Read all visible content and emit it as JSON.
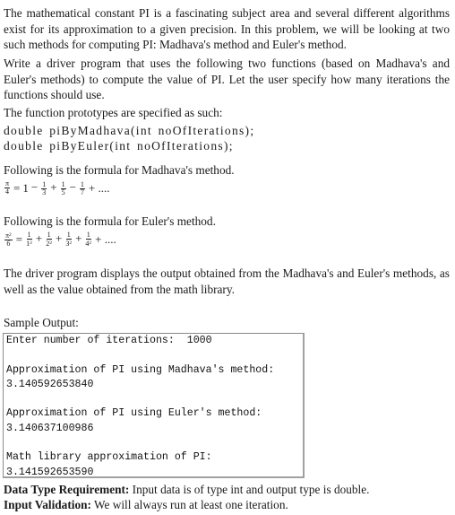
{
  "intro": {
    "paragraph1": "The mathematical constant PI is a fascinating subject area and several different algorithms exist for its approximation to a given precision. In this problem, we will be looking at two such methods for computing PI: Madhava's method and Euler's method.",
    "paragraph2": "Write a driver program that uses the following two functions (based on Madhava's and Euler's methods) to compute the value of PI. Let the user specify how many iterations the functions should use.",
    "prototypes_label": "The function prototypes are specified as such:"
  },
  "prototypes": [
    "double piByMadhava(int noOfIterations);",
    "double piByEuler(int noOfIterations);"
  ],
  "madhava": {
    "label": "Following is the formula for Madhava's method.",
    "lhs_num": "π",
    "lhs_den": "4",
    "first_term": "1",
    "terms": [
      {
        "op": "−",
        "num": "1",
        "den": "3"
      },
      {
        "op": "+",
        "num": "1",
        "den": "5"
      },
      {
        "op": "−",
        "num": "1",
        "den": "7"
      }
    ],
    "tail": "+ ...."
  },
  "euler": {
    "label": "Following is the formula for Euler's method.",
    "lhs_num": "π",
    "lhs_exp": "2",
    "lhs_den": "6",
    "terms": [
      {
        "op": "",
        "num": "1",
        "den": "1",
        "exp": "2"
      },
      {
        "op": "+",
        "num": "1",
        "den": "2",
        "exp": "2"
      },
      {
        "op": "+",
        "num": "1",
        "den": "3",
        "exp": "2"
      },
      {
        "op": "+",
        "num": "1",
        "den": "4",
        "exp": "2"
      }
    ],
    "tail": "+ ...."
  },
  "driver_text": "The driver program displays the output obtained from the Madhava's and Euler's methods, as well as the value obtained from the math library.",
  "sample_output": {
    "label": "Sample Output:",
    "lines": [
      "Enter number of iterations:  1000",
      "",
      "Approximation of PI using Madhava's method:",
      "3.140592653840",
      "",
      "Approximation of PI using Euler's method:",
      "3.140637100986",
      "",
      "Math library approximation of PI:",
      "3.141592653590"
    ]
  },
  "requirements": {
    "data_type_label": "Data Type Requirement:",
    "data_type_text": " Input data is of type int and output type is double.",
    "validation_label": "Input Validation:",
    "validation_text": " We will always run at least one iteration."
  }
}
